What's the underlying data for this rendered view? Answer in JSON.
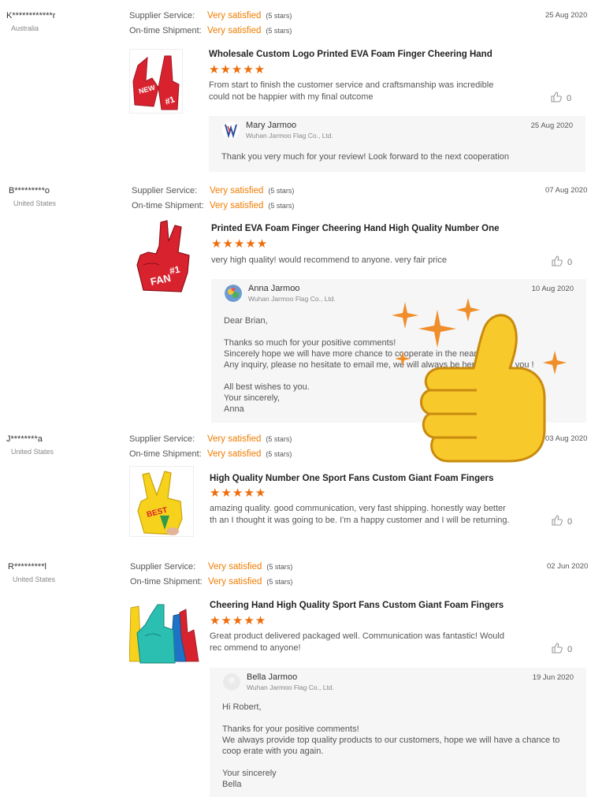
{
  "labels": {
    "supplier_service": "Supplier Service:",
    "ontime_shipment": "On-time Shipment:",
    "very_satisfied": "Very satisfied",
    "five_stars": "(5 stars)",
    "star_glyphs": "★★★★★"
  },
  "reviews": [
    {
      "buyer": "K************r",
      "country": "Australia",
      "date": "25 Aug 2020",
      "product_title": "Wholesale Custom Logo Printed EVA Foam Finger Cheering Hand",
      "comment": "From start to finish the customer service and craftsmanship was incredible could not be happier with my final outcome",
      "likes": "0",
      "reply": {
        "name": "Mary Jarmoo",
        "company": "Wuhan Jarmoo Flag Co., Ltd.",
        "date": "25 Aug 2020",
        "text": "Thank you very much for your review! Look forward to the next cooperation"
      }
    },
    {
      "buyer": "B*********o",
      "country": "United States",
      "date": "07 Aug 2020",
      "product_title": "Printed EVA Foam Finger Cheering Hand High Quality Number One",
      "comment": "very high quality! would recommend to anyone. very fair price",
      "likes": "0",
      "reply": {
        "name": "Anna Jarmoo",
        "company": "Wuhan Jarmoo Flag Co., Ltd.",
        "date": "10 Aug 2020",
        "text": "Dear Brian,\n\nThanks so much for your positive comments!\nSincerely hope we will have more chance to cooperate in the near future.\nAny inquiry, please no hesitate to email me, we will always be here to serve you !\n\nAll best wishes to you.\nYour sincerely,\nAnna"
      }
    },
    {
      "buyer": "J********a",
      "country": "United States",
      "date": "03 Aug 2020",
      "product_title": "High Quality Number One Sport Fans Custom Giant Foam Fingers",
      "comment": "amazing quality. good communication, very fast shipping.  honestly way better th an I thought it was going to be. I'm a happy customer and I will be returning.",
      "likes": "0"
    },
    {
      "buyer": "R*********l",
      "country": "United States",
      "date": "02 Jun 2020",
      "product_title": "Cheering Hand High Quality Sport Fans Custom Giant Foam Fingers",
      "comment": "Great product delivered packaged well.  Communication was fantastic!  Would rec ommend to anyone!",
      "likes": "0",
      "reply": {
        "name": "Bella Jarmoo",
        "company": "Wuhan Jarmoo Flag Co., Ltd.",
        "date": "19 Jun 2020",
        "text": "Hi Robert,\n\nThanks for your positive comments!\nWe always provide top quality products to our customers, hope we will have a chance to coop erate with you again.\n\nYour sincerely\nBella"
      }
    }
  ],
  "colors": {
    "accent_orange": "#f07c00",
    "star_orange": "#ef6c0a",
    "reply_bg": "#f6f6f6",
    "foam_red": "#d8232f",
    "foam_yellow": "#f7d21c",
    "sticker_yellow": "#f8c92a"
  },
  "icons": {
    "like": "thumbs-up-outline-icon",
    "sticker": "thumbs-up-emoji-sticker",
    "sparkle": "sparkle-icon"
  }
}
